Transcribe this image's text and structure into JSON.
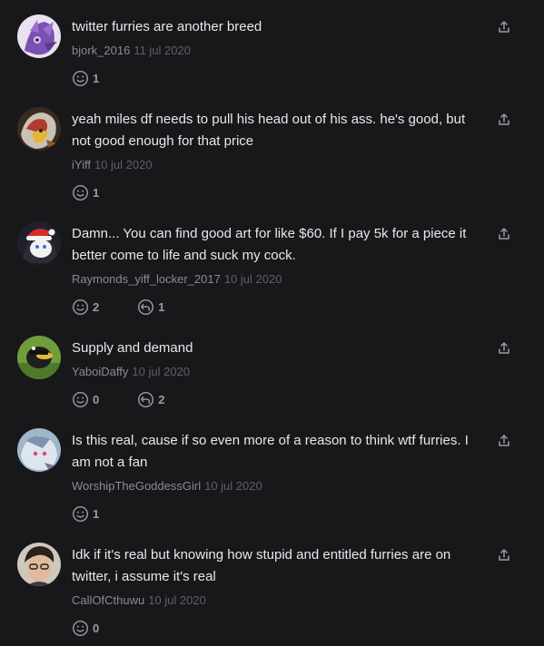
{
  "comments": [
    {
      "text": "twitter furries are another breed",
      "author": "bjork_2016",
      "date": "11 jul 2020",
      "reactions": "1",
      "replies": null
    },
    {
      "text": "yeah miles df needs to pull his head out of his ass. he's good, but not good enough for that price",
      "author": "iYiff",
      "date": "10 jul 2020",
      "reactions": "1",
      "replies": null
    },
    {
      "text": "Damn... You can find good art for like $60. If I pay 5k for a piece it better come to life and suck my cock.",
      "author": "Raymonds_yiff_locker_2017",
      "date": "10 jul 2020",
      "reactions": "2",
      "replies": "1"
    },
    {
      "text": "Supply and demand",
      "author": "YaboiDaffy",
      "date": "10 jul 2020",
      "reactions": "0",
      "replies": "2"
    },
    {
      "text": "Is this real, cause if so even more of a reason to think wtf furries. I am not a fan",
      "author": "WorshipTheGoddessGirl",
      "date": "10 jul 2020",
      "reactions": "1",
      "replies": null
    },
    {
      "text": "Idk if it's real but knowing how stupid and entitled furries are on twitter, i assume it's real",
      "author": "CallOfCthuwu",
      "date": "10 jul 2020",
      "reactions": "0",
      "replies": null
    }
  ],
  "icons": {
    "reaction": "smiley-face-icon",
    "reply": "reply-arrow-icon",
    "share": "share-upload-icon"
  },
  "colors": {
    "background": "#18181b",
    "text": "#e8e8ec",
    "username": "#8a8a93",
    "date": "#5f5f68",
    "icon": "#9a9aa3"
  }
}
